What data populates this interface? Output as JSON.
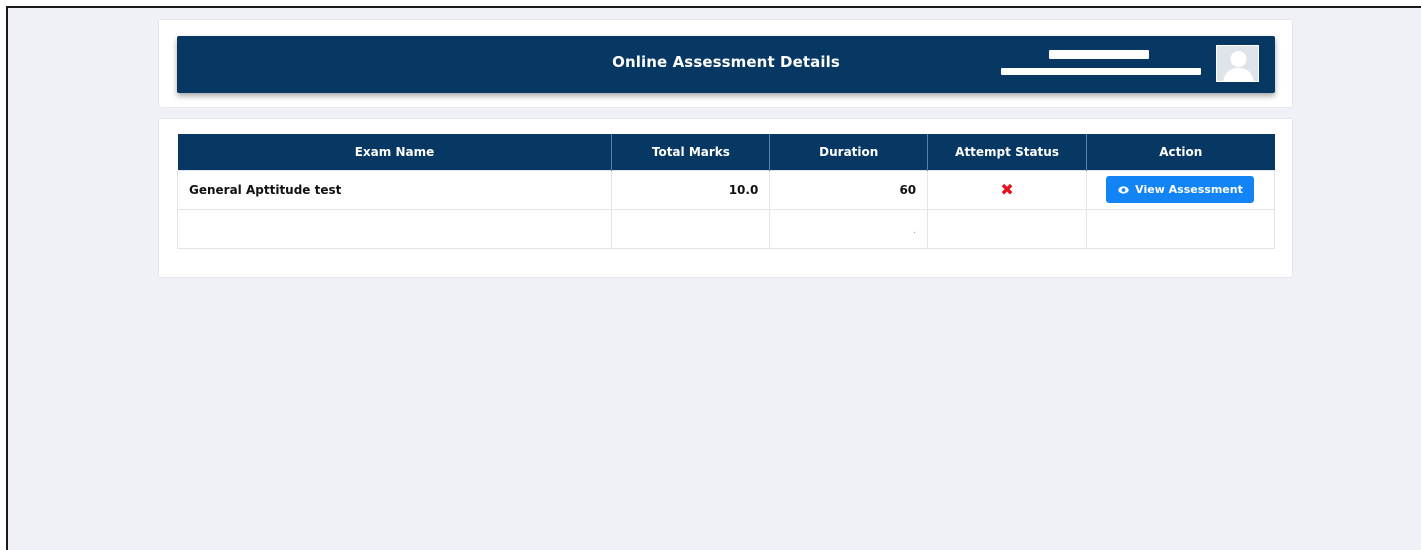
{
  "header": {
    "title": "Online Assessment Details",
    "user_name": "",
    "user_email": ""
  },
  "table": {
    "columns": [
      "Exam Name",
      "Total Marks",
      "Duration",
      "Attempt Status",
      "Action"
    ],
    "rows": [
      {
        "exam_name": "General Apttitude test",
        "total_marks": "10.0",
        "duration": "60",
        "attempt_status_icon": "cross-icon",
        "action_label": "View Assessment",
        "action_icon": "eye-icon"
      },
      {
        "exam_name": "",
        "total_marks": "",
        "duration": ".",
        "attempt_status_icon": "",
        "action_label": ""
      }
    ]
  },
  "colors": {
    "banner": "#073763",
    "page_background": "#f0f1f6",
    "button": "#1384f5",
    "status_cross": "#e8111b"
  }
}
